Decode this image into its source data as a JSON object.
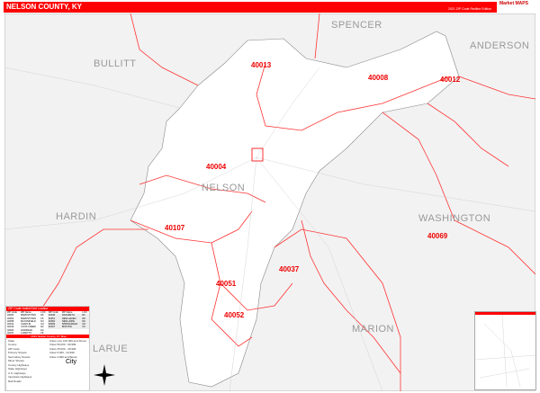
{
  "header": {
    "title": "NELSON COUNTY, KY",
    "edition": "2021 ZIP Code Redline Edition",
    "logo": "Market MAPS"
  },
  "colors": {
    "accent": "#ff0000",
    "zip_boundary": "#ff3333",
    "background": "#f2f2f2",
    "county": "#ffffff"
  },
  "counties": [
    {
      "name": "SPENCER"
    },
    {
      "name": "ANDERSON"
    },
    {
      "name": "BULLITT"
    },
    {
      "name": "NELSON"
    },
    {
      "name": "HARDIN"
    },
    {
      "name": "WASHINGTON"
    },
    {
      "name": "MARION"
    },
    {
      "name": "LARUE"
    }
  ],
  "zips": [
    "40013",
    "40008",
    "40012",
    "40004",
    "40107",
    "40069",
    "40037",
    "40051",
    "40052"
  ],
  "legend": {
    "title": "ZIP Code Index/Grid Locator",
    "headers": [
      "ZIP Code",
      "ZIP Name",
      "LOC"
    ],
    "rows_left": [
      [
        "40004",
        "BARDSTOWN",
        "E5"
      ],
      [
        "40004",
        "BARDSTOWN",
        "F5"
      ],
      [
        "40008",
        "BLOOMFIELD",
        "D3"
      ],
      [
        "40012",
        "CHAPLIN",
        "G3"
      ],
      [
        "40013",
        "COXS CREEK",
        "D2"
      ],
      [
        "40020",
        "FAIRFIELD",
        "E3"
      ],
      [
        "40037",
        "LORETTO",
        "F8"
      ]
    ],
    "rows_right": [
      [
        "40048",
        "NAZARETH",
        "E5"
      ],
      [
        "40051",
        "NEW HAVEN",
        "D8"
      ],
      [
        "40052",
        "NEW HOPE",
        "D9"
      ],
      [
        "40069",
        "SPRINGFIELD",
        "G6"
      ],
      [
        "40107",
        "BOSTON",
        "C6"
      ]
    ],
    "map_title": "2021 Nelson County, KY Map",
    "items": [
      "State",
      "County",
      "ZIP Code",
      "Primary Streets",
      "Secondary Streets",
      "Minor Streets",
      "County Highways",
      "State Highways",
      "U.S. Highways",
      "Interstate Highways",
      "Rail Roads"
    ],
    "city_sizes": [
      "Cities over 100,000 and Above",
      "Cities 50,000 - 99,999",
      "Cities 25,000 - 49,999",
      "Cities 5,000 - 24,999",
      "Cities 4,999 and Below"
    ],
    "city_glyph": "City"
  }
}
